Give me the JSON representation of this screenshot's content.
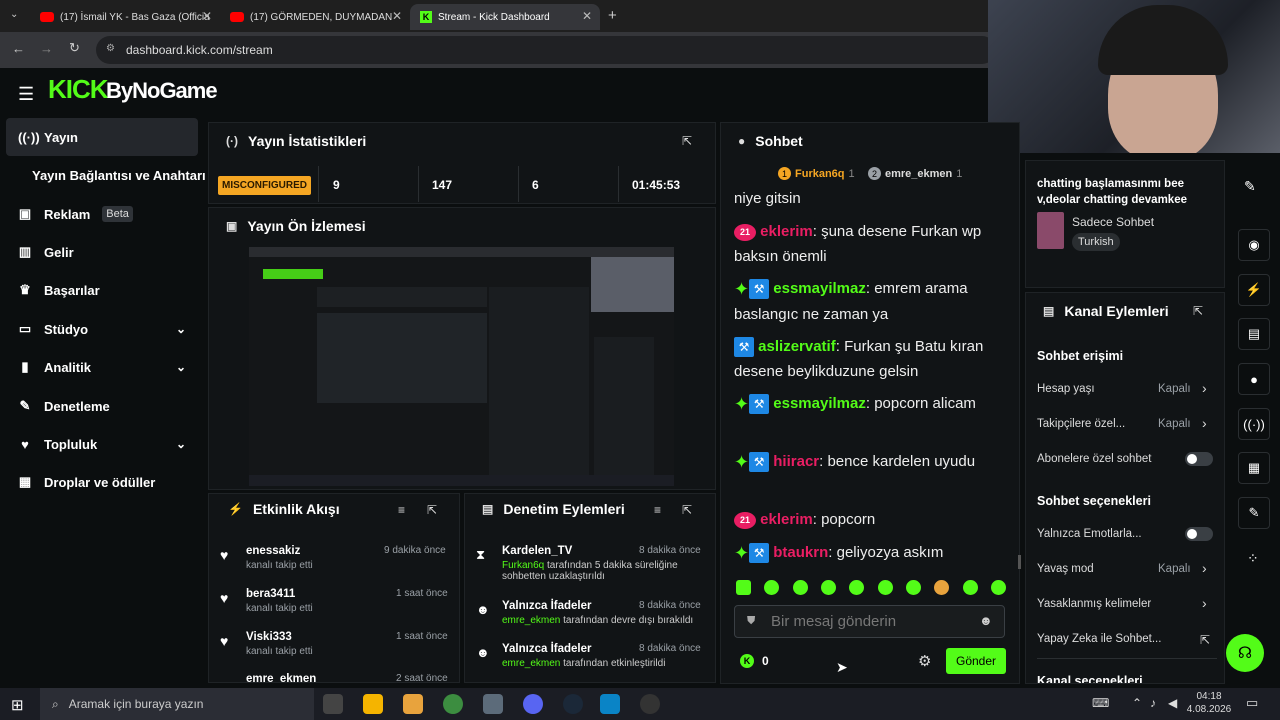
{
  "browser": {
    "tabs": [
      {
        "title": "(17) İsmail YK - Bas Gaza (Officia"
      },
      {
        "title": "(17) GÖRMEDEN, DUYMADAN"
      },
      {
        "title": "Stream - Kick Dashboard"
      }
    ],
    "url": "dashboard.kick.com/stream"
  },
  "header": {
    "logo_text": "KICK",
    "overlay_text": "ByNoGame"
  },
  "sidebar": {
    "items": [
      {
        "label": "Yayın",
        "icon": "broadcast-icon"
      },
      {
        "label": "Yayın Bağlantısı ve Anahtarı"
      },
      {
        "label": "Reklam",
        "badge": "Beta",
        "icon": "ad-icon"
      },
      {
        "label": "Gelir",
        "icon": "chart-icon"
      },
      {
        "label": "Başarılar",
        "icon": "trophy-icon"
      },
      {
        "label": "Stüdyo",
        "icon": "studio-icon"
      },
      {
        "label": "Analitik",
        "icon": "analytics-icon"
      },
      {
        "label": "Denetleme",
        "icon": "wrench-icon"
      },
      {
        "label": "Topluluk",
        "icon": "community-icon"
      },
      {
        "label": "Droplar ve ödüller",
        "icon": "drops-icon"
      }
    ]
  },
  "stats": {
    "title": "Yayın İstatistikleri",
    "status": "MISCONFIGURED",
    "values": [
      "9",
      "147",
      "6",
      "01:45:53"
    ]
  },
  "preview": {
    "title": "Yayın Ön İzlemesi"
  },
  "activity": {
    "title": "Etkinlik Akışı",
    "items": [
      {
        "name": "enessakiz",
        "sub": "kanalı takip etti",
        "time": "9 dakika önce"
      },
      {
        "name": "bera3411",
        "sub": "kanalı takip etti",
        "time": "1 saat önce"
      },
      {
        "name": "Viski333",
        "sub": "kanalı takip etti",
        "time": "1 saat önce"
      },
      {
        "name": "emre_ekmen",
        "sub": "",
        "time": "2 saat önce"
      }
    ]
  },
  "moderation": {
    "title": "Denetim Eylemleri",
    "items": [
      {
        "name": "Kardelen_TV",
        "time": "8 dakika önce",
        "actor": "Furkan6q",
        "text": " tarafından 5 dakika süreliğine sohbetten uzaklaştırıldı"
      },
      {
        "name": "Yalnızca İfadeler",
        "time": "8 dakika önce",
        "actor": "emre_ekmen",
        "text": " tarafından devre dışı bırakıldı"
      },
      {
        "name": "Yalnızca İfadeler",
        "time": "8 dakika önce",
        "actor": "emre_ekmen",
        "text": " tarafından etkinleştirildi"
      }
    ]
  },
  "chat": {
    "title": "Sohbet",
    "top_chatters": [
      {
        "name": "Furkan6q",
        "count": "1",
        "rank": "1"
      },
      {
        "name": "emre_ekmen",
        "count": "1",
        "rank": "2"
      }
    ],
    "messages": [
      {
        "user": "",
        "text": "niye gitsin",
        "color": "#eeeeee",
        "badges": []
      },
      {
        "user": "eklerim",
        "text": "şuna desene Furkan wp baksın önemli",
        "color": "#e91e63",
        "badges": [
          "21"
        ]
      },
      {
        "user": "essmayilmaz",
        "text": "emrem arama baslangıc ne zaman ya",
        "color": "#53fc18",
        "badges": [
          "star",
          "hammer"
        ]
      },
      {
        "user": "aslizervatif",
        "text": "Furkan şu Batu kıran desene beylikduzune gelsin",
        "color": "#53fc18",
        "badges": [
          "hammer"
        ]
      },
      {
        "user": "essmayilmaz",
        "text": "popcorn alicam",
        "color": "#53fc18",
        "badges": [
          "star",
          "hammer"
        ]
      },
      {
        "user": "hiiracr",
        "text": "bence kardelen uyudu",
        "color": "#e91e63",
        "badges": [
          "star",
          "hammer"
        ]
      },
      {
        "user": "eklerim",
        "text": "popcorn",
        "color": "#e91e63",
        "badges": [
          "21"
        ]
      },
      {
        "user": "btaukrn",
        "text": "geliyozya askım",
        "color": "#e91e63",
        "badges": [
          "star",
          "hammer"
        ]
      }
    ],
    "input_placeholder": "Bir mesaj gönderin",
    "points": "0",
    "send_label": "Gönder"
  },
  "channel_info": {
    "title_text": "chatting başlamasınmı bee v,deolar chatting devamkee",
    "category": "Sadece Sohbet",
    "language": "Turkish"
  },
  "channel_actions": {
    "title": "Kanal Eylemleri",
    "section_chat_access": "Sohbet erişimi",
    "rows_access": [
      {
        "label": "Hesap yaşı",
        "value": "Kapalı"
      },
      {
        "label": "Takipçilere özel...",
        "value": "Kapalı"
      },
      {
        "label": "Abonelere özel sohbet",
        "value": ""
      }
    ],
    "section_chat_options": "Sohbet seçenekleri",
    "rows_options": [
      {
        "label": "Yalnızca Emotlarla...",
        "value": ""
      },
      {
        "label": "Yavaş mod",
        "value": "Kapalı"
      },
      {
        "label": "Yasaklanmış kelimeler",
        "value": ""
      },
      {
        "label": "Yapay Zeka ile Sohbet...",
        "value": ""
      }
    ],
    "section_channel_options": "Kanal seçenekleri"
  },
  "taskbar": {
    "search_placeholder": "Aramak için buraya yazın",
    "time": "04:18",
    "date": "4.08.2026"
  }
}
